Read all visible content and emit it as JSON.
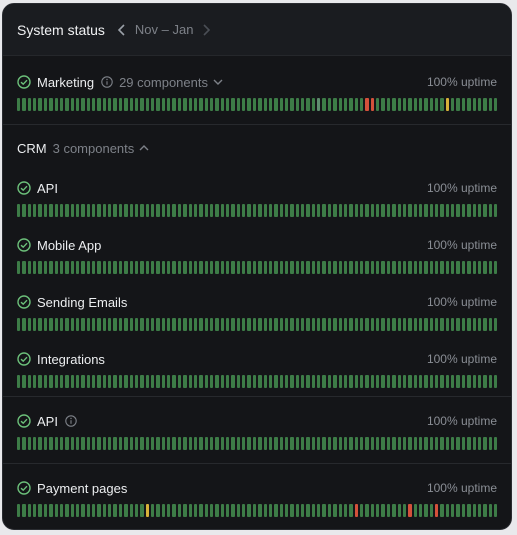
{
  "header": {
    "title": "System status",
    "range": "Nov – Jan"
  },
  "colors": {
    "ok": "#3d7c47",
    "warn": "#d8b23a",
    "down": "#d4513b",
    "maint": "#5e8c6e",
    "check": "#6cc07a"
  },
  "marketing": {
    "name": "Marketing",
    "count": "29 components",
    "uptime": "100% uptime",
    "bars": {
      "total": 90,
      "down": [
        65,
        66
      ],
      "warn": [
        80
      ],
      "maint": [
        56
      ]
    }
  },
  "crm": {
    "name": "CRM",
    "count": "3 components",
    "items": [
      {
        "name": "API",
        "uptime": "100% uptime",
        "bars": {
          "total": 90,
          "down": [],
          "warn": [],
          "maint": []
        }
      },
      {
        "name": "Mobile App",
        "uptime": "100% uptime",
        "bars": {
          "total": 90,
          "down": [],
          "warn": [],
          "maint": []
        }
      },
      {
        "name": "Sending Emails",
        "uptime": "100% uptime",
        "bars": {
          "total": 90,
          "down": [],
          "warn": [],
          "maint": []
        }
      },
      {
        "name": "Integrations",
        "uptime": "100% uptime",
        "bars": {
          "total": 90,
          "down": [],
          "warn": [],
          "maint": []
        }
      }
    ]
  },
  "api": {
    "name": "API",
    "uptime": "100% uptime",
    "bars": {
      "total": 90,
      "down": [],
      "warn": [],
      "maint": []
    }
  },
  "payment": {
    "name": "Payment pages",
    "uptime": "100% uptime",
    "bars": {
      "total": 90,
      "down": [
        63,
        73,
        78
      ],
      "warn": [
        24
      ],
      "maint": []
    }
  }
}
